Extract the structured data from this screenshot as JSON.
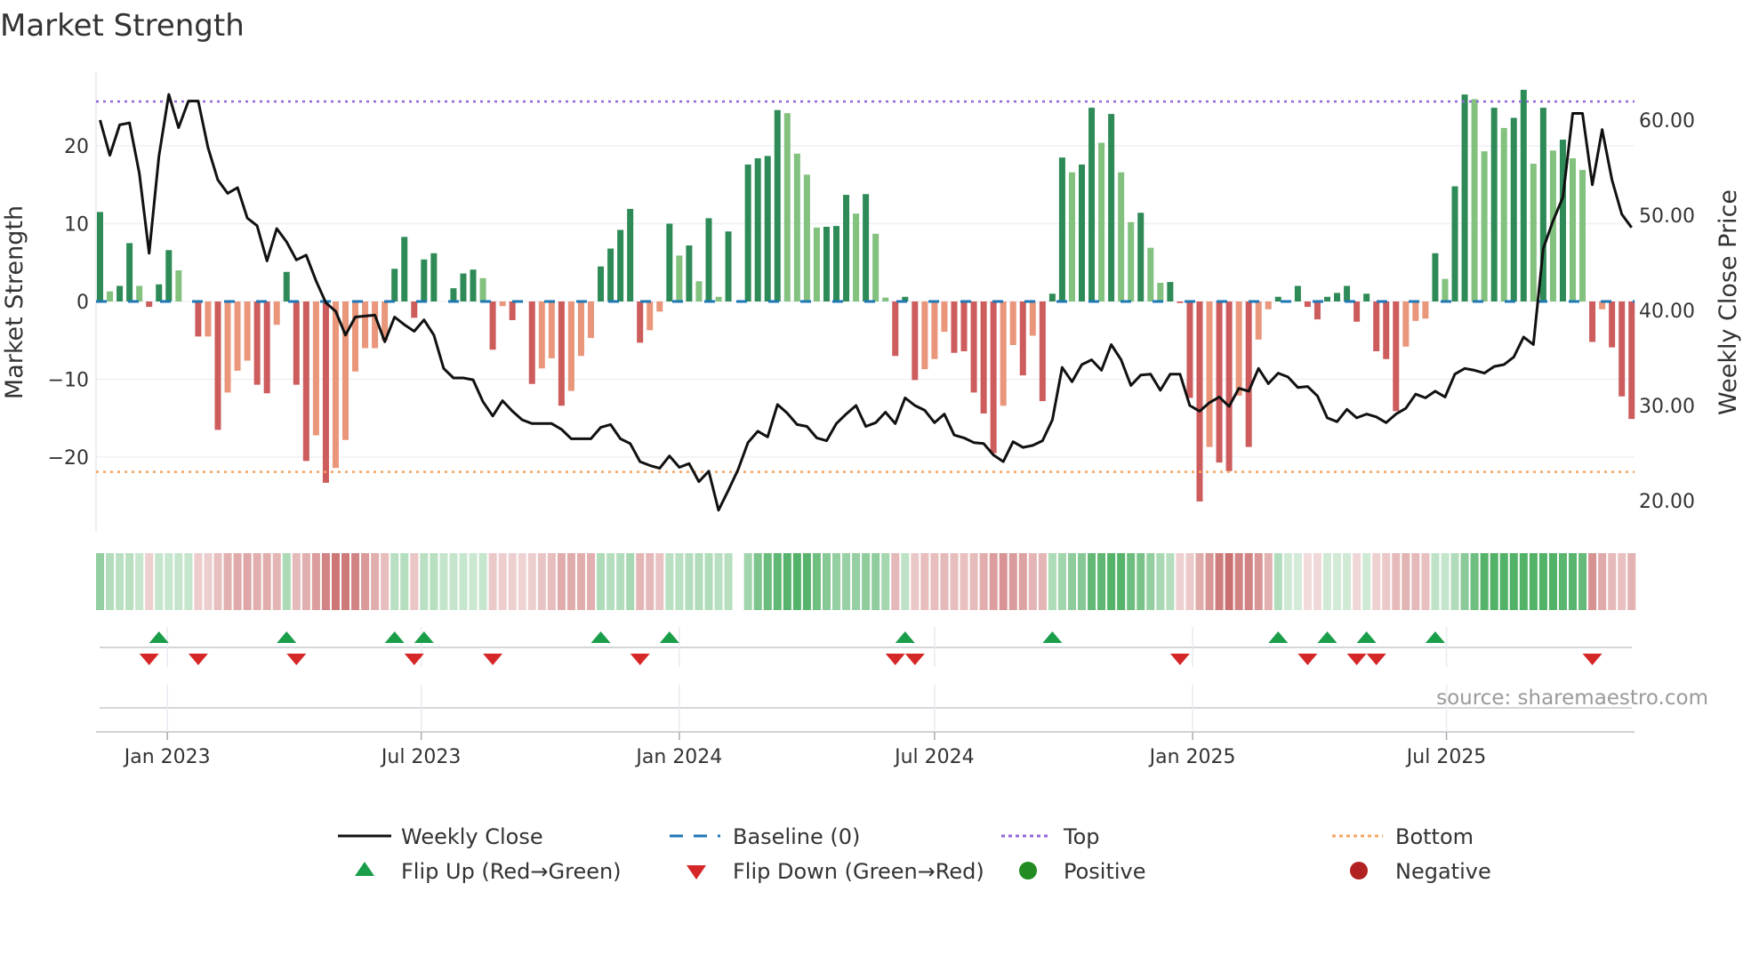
{
  "title": "Market Strength",
  "source": "source: sharemaestro.com",
  "chart_data": {
    "type": "bar",
    "title": "Market Strength",
    "ylabel": "Market Strength",
    "y2label": "Weekly Close Price",
    "ylim": [
      -28,
      30
    ],
    "y2lim": [
      17,
      66
    ],
    "yticks": [
      "20",
      "10",
      "0",
      "−10",
      "−20"
    ],
    "ytick_values": [
      20,
      10,
      0,
      -10,
      -20
    ],
    "y2ticks": [
      "60.00",
      "50.00",
      "40.00",
      "30.00",
      "20.00"
    ],
    "y2tick_values": [
      60,
      50,
      40,
      30,
      20
    ],
    "xticks": [
      "Jan 2023",
      "Jul 2023",
      "Jan 2024",
      "Jul 2024",
      "Jan 2025",
      "Jul 2025"
    ],
    "xtick_dates": [
      "2023-01-01",
      "2023-07-01",
      "2024-01-01",
      "2024-07-01",
      "2025-01-01",
      "2025-07-01"
    ],
    "start_week": "2022-11-14",
    "top_level": 25.7,
    "bottom_level": -21.9,
    "strength": [
      11.5,
      1.3,
      2.0,
      7.5,
      2.0,
      -0.7,
      2.2,
      6.6,
      4.0,
      0,
      -4.5,
      -4.5,
      -16.5,
      -11.7,
      -8.9,
      -7.6,
      -10.7,
      -11.8,
      -3.0,
      3.8,
      -10.7,
      -20.5,
      -17.2,
      -23.3,
      -21.4,
      -17.8,
      -9.0,
      -6.0,
      -6.0,
      -5.0,
      4.2,
      8.3,
      -2.1,
      5.4,
      6.2,
      0,
      1.7,
      3.6,
      4.1,
      3.0,
      -6.2,
      -0.6,
      -2.4,
      0,
      -10.6,
      -8.6,
      -7.3,
      -13.4,
      -11.5,
      -7.0,
      -4.7,
      4.5,
      6.8,
      9.2,
      11.9,
      -5.3,
      -3.7,
      -1.3,
      10.0,
      5.9,
      7.2,
      2.6,
      10.7,
      0.6,
      9.0,
      null,
      17.6,
      18.4,
      18.7,
      24.6,
      24.2,
      19.0,
      16.3,
      9.5,
      9.6,
      9.7,
      13.7,
      11.3,
      13.8,
      8.7,
      0.5,
      -7.0,
      0.6,
      -10.1,
      -8.7,
      -7.4,
      -3.9,
      -6.6,
      -6.4,
      -11.7,
      -14.4,
      -19.5,
      -13.4,
      -5.6,
      -9.5,
      -4.4,
      -12.8,
      1.0,
      18.5,
      16.6,
      17.6,
      24.9,
      20.4,
      24.1,
      16.6,
      10.2,
      11.4,
      6.9,
      2.4,
      2.5,
      -0.2,
      -12.4,
      -25.7,
      -18.7,
      -20.7,
      -21.8,
      -12.1,
      -18.7,
      -4.9,
      -1.0,
      0.6,
      0.1,
      2.0,
      -0.7,
      -2.3,
      0.6,
      1.1,
      2.0,
      -2.6,
      1.0,
      -6.4,
      -7.4,
      -14.1,
      -5.8,
      -2.5,
      -2.2,
      6.2,
      2.9,
      14.8,
      26.6,
      26.0,
      19.3,
      24.9,
      22.3,
      23.6,
      27.2,
      17.7,
      24.9,
      19.4,
      20.8,
      18.4,
      16.9,
      -5.2,
      -1.0,
      -5.9,
      -12.2,
      -15.1
    ],
    "shade": "DLDDLDDDLDDLDLLLDDLDDDLDLLLLLLDDDDDDDDDLDLDDDLLDLLLDDDDDLLDLDLDLDDDDDDLLLLDDDLDLLDDDLLLDDDDDLLDLDDDLDDLDLLDLLDDDDLDDLDLLDLDDDDDDDDDDDLLLDLDDLLDLDDLDLDLLDLDDD",
    "weekly_close": [
      60.0,
      56.3,
      59.5,
      59.7,
      54.4,
      46.0,
      56.2,
      62.7,
      59.2,
      62.0,
      62.0,
      57.1,
      53.7,
      52.3,
      52.9,
      49.7,
      48.9,
      45.2,
      48.6,
      47.2,
      45.3,
      45.8,
      43.1,
      40.8,
      39.9,
      37.4,
      39.3,
      39.4,
      39.5,
      36.7,
      39.3,
      38.5,
      37.8,
      39.0,
      37.4,
      33.9,
      32.9,
      32.9,
      32.7,
      30.4,
      28.9,
      30.5,
      29.4,
      28.5,
      28.1,
      28.1,
      28.1,
      27.5,
      26.5,
      26.5,
      26.5,
      27.7,
      28.0,
      26.5,
      26.0,
      24.1,
      23.7,
      23.4,
      24.7,
      23.5,
      23.9,
      22.0,
      23.1,
      19.0,
      21.1,
      23.3,
      26.1,
      27.3,
      26.7,
      30.1,
      29.2,
      28.0,
      27.8,
      26.6,
      26.3,
      28.1,
      29.1,
      30.0,
      27.8,
      28.2,
      29.3,
      28.1,
      30.8,
      30.0,
      29.5,
      28.2,
      29.1,
      26.9,
      26.6,
      26.1,
      26.0,
      24.8,
      24.1,
      26.2,
      25.6,
      25.8,
      26.3,
      28.5,
      34.0,
      32.5,
      34.3,
      34.8,
      33.7,
      36.4,
      34.8,
      32.1,
      33.2,
      33.3,
      31.6,
      33.3,
      33.3,
      30.0,
      29.4,
      30.3,
      30.9,
      29.9,
      31.8,
      31.5,
      33.9,
      32.3,
      33.4,
      33.0,
      31.9,
      32.0,
      31.0,
      28.7,
      28.3,
      29.6,
      28.7,
      29.1,
      28.8,
      28.2,
      29.1,
      29.7,
      31.2,
      30.8,
      31.5,
      30.9,
      33.3,
      33.9,
      33.7,
      33.4,
      34.1,
      34.3,
      35.1,
      37.2,
      36.4,
      46.5,
      49.4,
      51.9,
      60.7,
      60.7,
      53.2,
      59.0,
      53.7,
      50.1,
      48.7
    ],
    "legend": {
      "placement": "bottom",
      "weekly_close": "Weekly Close",
      "baseline": "Baseline (0)",
      "top": "Top",
      "bottom": "Bottom",
      "flip_up": "Flip Up (Red→Green)",
      "flip_down": "Flip Down (Green→Red)",
      "positive": "Positive",
      "negative": "Negative"
    },
    "colors": {
      "pos_dark": "#2e8b57",
      "pos_light": "#82c17e",
      "neg_dark": "#cd5c5c",
      "neg_light": "#e9967a",
      "line": "#111111",
      "baseline": "#1f77b4",
      "top": "#9467db",
      "bottom": "#f4a460",
      "flip_up": "#1a9e4a",
      "flip_down": "#d62728",
      "positive": "#228b22",
      "negative": "#b22222",
      "heat_pos": "#3fa957",
      "heat_neg": "#c45f5f"
    }
  }
}
